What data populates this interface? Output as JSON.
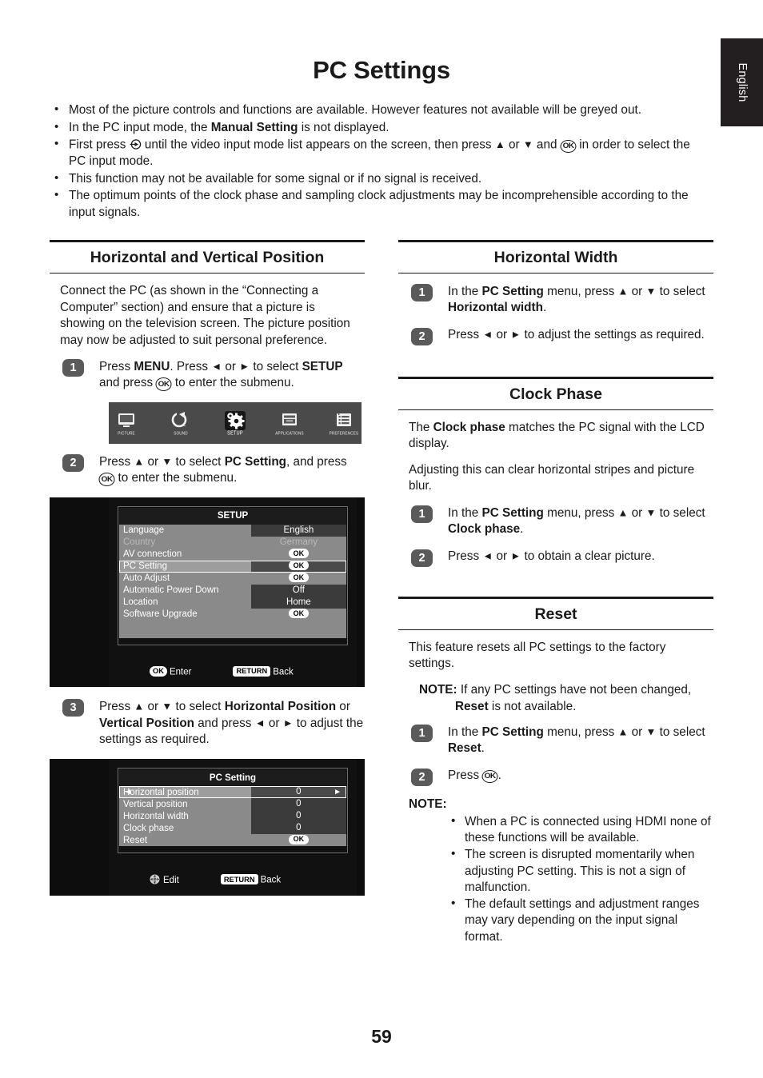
{
  "language_tab": {
    "label": "English"
  },
  "page_title": "PC Settings",
  "page_number": "59",
  "intro_bullets": [
    "Most of the picture controls and functions are available. However features not available will be greyed out.",
    "In the PC input mode, the <b>Manual Setting</b> is not displayed.",
    "First press <span class=\"src-glyph\" data-name=\"input-source-icon\" data-interactable=\"false\"><svg width=\"15\" height=\"15\" viewBox=\"0 0 15 15\"><circle cx=\"8\" cy=\"7.5\" r=\"5.6\" fill=\"none\" stroke=\"#1a1a1a\" stroke-width=\"1.3\"/><line x1=\"0.5\" y1=\"7.5\" x2=\"9\" y2=\"7.5\" stroke=\"#1a1a1a\" stroke-width=\"1.3\"/><polygon points=\"11,7.5 6.5,4.9 6.5,10.1\" fill=\"#1a1a1a\"/></svg></span> until the video input mode list appears on the screen, then press <span class=\"arrow\">▲</span> or <span class=\"arrow\">▼</span> and <span class=\"ok-glyph\">OK</span> in order to select the PC input mode.",
    "This function may not be available for some signal or if no signal is received.",
    "The optimum points of the clock phase and sampling clock adjustments may be incomprehensible according to the input signals."
  ],
  "sections": {
    "horizontal_vertical_position": {
      "heading": "Horizontal and Vertical Position",
      "intro": "Connect the PC (as shown in the “Connecting a Computer” section) and ensure that a picture is showing on the television screen. The picture position may now be adjusted to suit personal preference.",
      "steps": [
        {
          "num": "1",
          "text": "Press <b>MENU</b>. Press <span class=\"arrow\">◄</span> or <span class=\"arrow\">►</span> to select <b>SETUP</b> and press <span class=\"ok-glyph\">OK</span> to enter  the submenu."
        },
        {
          "num": "2",
          "text": "Press <span class=\"arrow\">▲</span> or <span class=\"arrow\">▼</span> to select <b>PC Setting</b>, and press <span class=\"ok-glyph\">OK</span> to enter the submenu."
        },
        {
          "num": "3",
          "text": "Press <span class=\"arrow\">▲</span> or <span class=\"arrow\">▼</span> to select <b>Horizontal Position</b> or <b>Vertical Position</b> and press <span class=\"arrow\">◄</span> or <span class=\"arrow\">►</span> to adjust the settings as required."
        }
      ]
    },
    "horizontal_width": {
      "heading": "Horizontal Width",
      "steps": [
        {
          "num": "1",
          "text": "In the <b>PC Setting</b> menu, press <span class=\"arrow\">▲</span> or <span class=\"arrow\">▼</span> to select <b>Horizontal width</b>."
        },
        {
          "num": "2",
          "text": "Press <span class=\"arrow\">◄</span> or <span class=\"arrow\">►</span> to adjust the settings as required."
        }
      ]
    },
    "clock_phase": {
      "heading": "Clock Phase",
      "intro1": "The <b>Clock phase</b> matches the PC signal with the LCD display.",
      "intro2": "Adjusting this can clear horizontal stripes and picture blur.",
      "steps": [
        {
          "num": "1",
          "text": "In the <b>PC Setting</b> menu, press <span class=\"arrow\">▲</span> or <span class=\"arrow\">▼</span> to select <b>Clock phase</b>."
        },
        {
          "num": "2",
          "text": "Press <span class=\"arrow\">◄</span> or <span class=\"arrow\">►</span> to obtain a clear picture."
        }
      ]
    },
    "reset": {
      "heading": "Reset",
      "intro": "This feature resets all PC settings to the factory settings.",
      "note_label": "NOTE:",
      "note_text": "If any PC settings have not been changed, <b>Reset</b> is not available.",
      "steps": [
        {
          "num": "1",
          "text": "In the <b>PC Setting</b> menu, press <span class=\"arrow\">▲</span> or <span class=\"arrow\">▼</span> to select <b>Reset</b>."
        },
        {
          "num": "2",
          "text": "Press <span class=\"ok-glyph\">OK</span>."
        }
      ],
      "note_head": "NOTE:",
      "note_bullets": [
        "When a PC is connected using HDMI none of these functions will be available.",
        "The screen is disrupted momentarily when adjusting PC setting. This is not a sign of malfunction.",
        "The default settings and adjustment ranges may vary depending on the input signal format."
      ]
    }
  },
  "osd": {
    "icon_bar": {
      "items": [
        {
          "label": "PICTURE",
          "icon": "tv-screen-icon",
          "selected": false
        },
        {
          "label": "SOUND",
          "icon": "speaker-knob-icon",
          "selected": false
        },
        {
          "label": "SETUP",
          "icon": "gear-icon",
          "selected": true
        },
        {
          "label": "APPLICATIONS",
          "icon": "window-app-icon",
          "selected": false
        },
        {
          "label": "PREFERENCES",
          "icon": "list-icon",
          "selected": false
        }
      ]
    },
    "setup_menu": {
      "title": "SETUP",
      "rows": [
        {
          "label": "Language",
          "value": "English",
          "type": "text",
          "state": "normal"
        },
        {
          "label": "Country",
          "value": "Germany",
          "type": "text",
          "state": "dim"
        },
        {
          "label": "AV connection",
          "value": "OK",
          "type": "chip",
          "state": "normal"
        },
        {
          "label": "PC Setting",
          "value": "OK",
          "type": "chip",
          "state": "selected"
        },
        {
          "label": "Auto Adjust",
          "value": "OK",
          "type": "chip",
          "state": "normal"
        },
        {
          "label": "Automatic Power Down",
          "value": "Off",
          "type": "text",
          "state": "normal"
        },
        {
          "label": "Location",
          "value": "Home",
          "type": "text",
          "state": "normal"
        },
        {
          "label": "Software Upgrade",
          "value": "OK",
          "type": "chip",
          "state": "normal"
        }
      ],
      "footer": [
        {
          "key": "OK",
          "key_style": "round",
          "label": "Enter"
        },
        {
          "key": "RETURN",
          "key_style": "square",
          "label": "Back"
        }
      ]
    },
    "pc_setting_menu": {
      "title": "PC Setting",
      "rows": [
        {
          "label": "Horizontal position",
          "value": "0",
          "type": "spinner",
          "state": "selected"
        },
        {
          "label": "Vertical position",
          "value": "0",
          "type": "text",
          "state": "normal"
        },
        {
          "label": "Horizontal width",
          "value": "0",
          "type": "text",
          "state": "normal"
        },
        {
          "label": "Clock phase",
          "value": "0",
          "type": "text",
          "state": "normal"
        },
        {
          "label": "Reset",
          "value": "OK",
          "type": "chip",
          "state": "normal"
        }
      ],
      "footer": [
        {
          "key": "dpad",
          "key_style": "dpad",
          "label": "Edit"
        },
        {
          "key": "RETURN",
          "key_style": "square",
          "label": "Back"
        }
      ]
    }
  }
}
